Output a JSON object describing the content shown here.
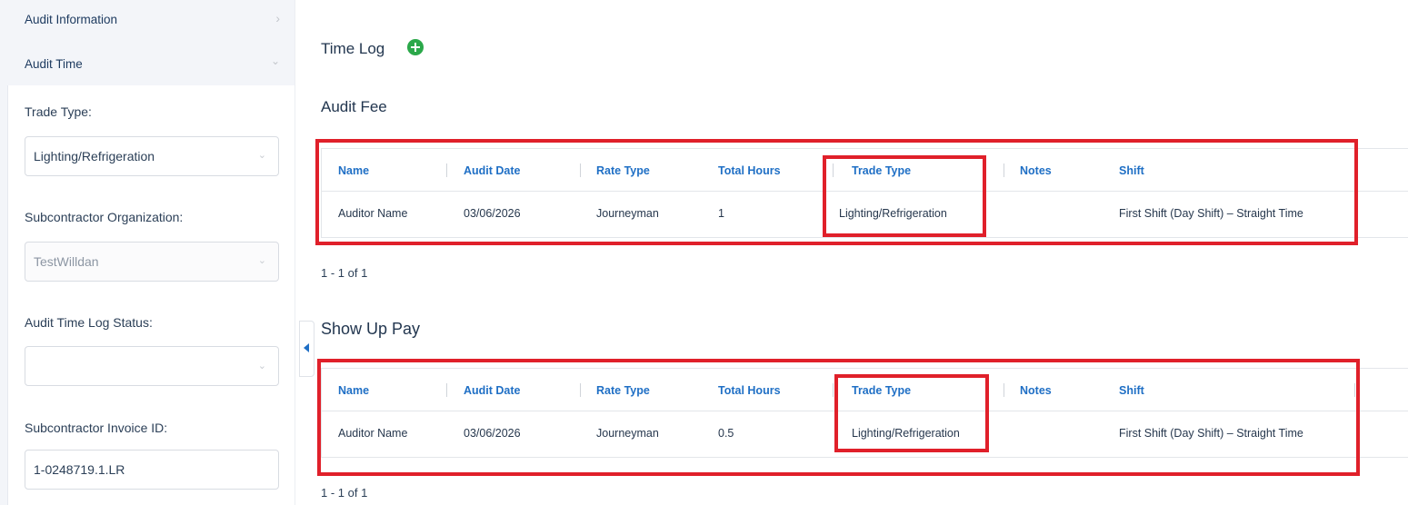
{
  "sidebar": {
    "accordion": [
      {
        "label": "Audit Information",
        "chevron": ">"
      },
      {
        "label": "Audit Time",
        "chevron": "⌄"
      }
    ],
    "fields": {
      "trade_type": {
        "label": "Trade Type:",
        "value": "Lighting/Refrigeration"
      },
      "subcontractor_org": {
        "label": "Subcontractor Organization:",
        "value": "TestWilldan"
      },
      "time_log_status": {
        "label": "Audit Time Log Status:",
        "value": ""
      },
      "invoice_id": {
        "label": "Subcontractor Invoice ID:",
        "value": "1-0248719.1.LR"
      }
    }
  },
  "main": {
    "time_log_title": "Time Log",
    "audit_fee": {
      "title": "Audit Fee",
      "columns": [
        "Name",
        "Audit Date",
        "Rate Type",
        "Total Hours",
        "Trade Type",
        "Notes",
        "Shift"
      ],
      "row": {
        "name": "Auditor Name",
        "audit_date": "03/06/2026",
        "rate_type": "Journeyman",
        "total_hours": "1",
        "trade_type": "Lighting/Refrigeration",
        "notes": "",
        "shift": "First Shift (Day Shift) – Straight Time"
      },
      "pager": "1 - 1 of 1"
    },
    "show_up_pay": {
      "title": "Show Up Pay",
      "columns": [
        "Name",
        "Audit Date",
        "Rate Type",
        "Total Hours",
        "Trade Type",
        "Notes",
        "Shift"
      ],
      "row": {
        "name": "Auditor Name",
        "audit_date": "03/06/2026",
        "rate_type": "Journeyman",
        "total_hours": "0.5",
        "trade_type": "Lighting/Refrigeration",
        "notes": "",
        "shift": "First Shift (Day Shift) – Straight Time"
      },
      "pager": "1 - 1 of 1"
    }
  },
  "colors": {
    "accent_blue": "#1f6fc5",
    "add_green": "#2ba84a",
    "highlight_red": "#e0202a"
  }
}
